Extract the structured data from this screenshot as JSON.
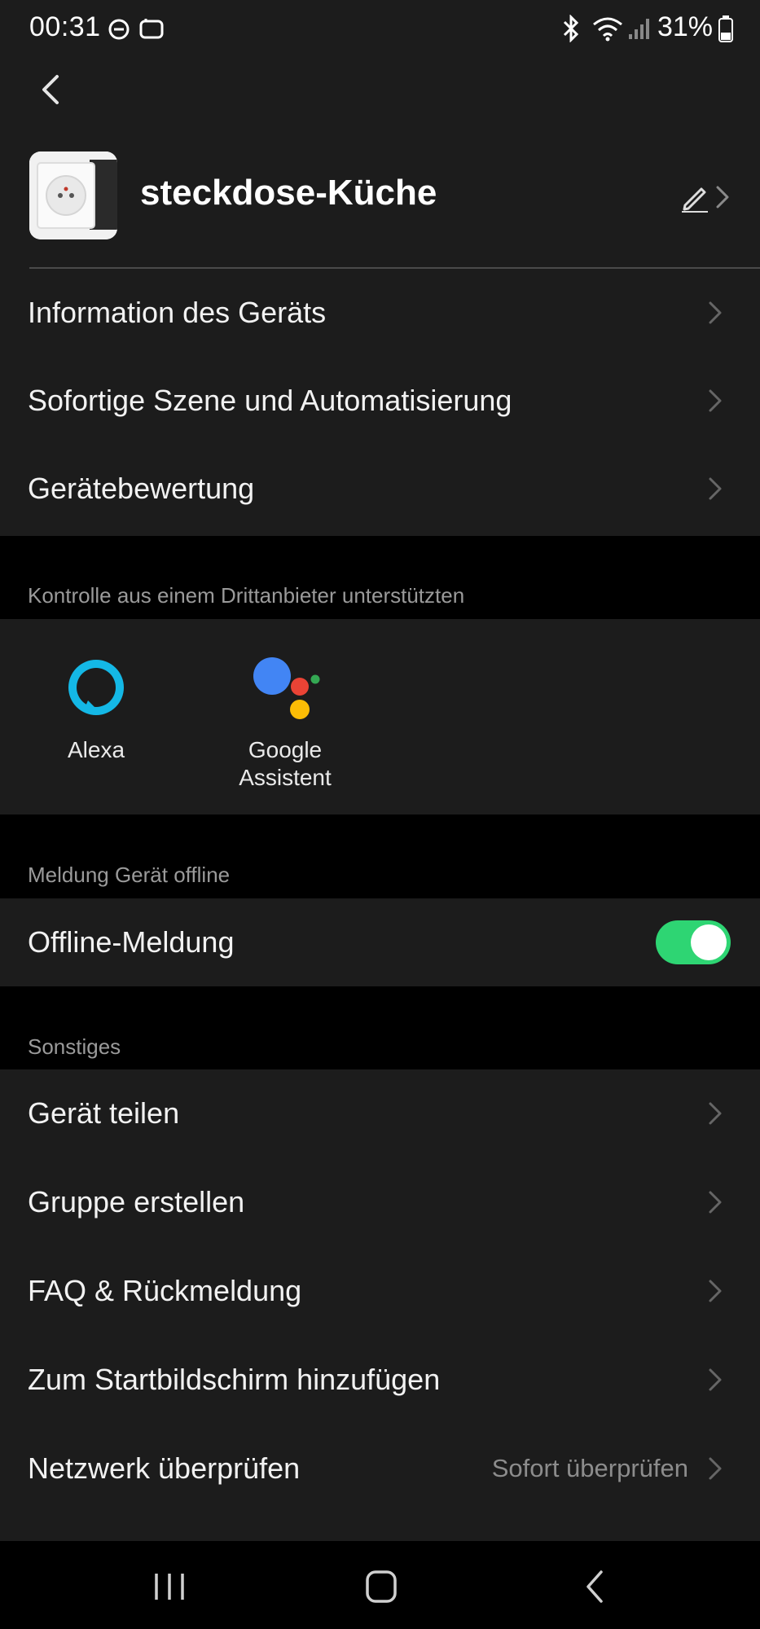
{
  "status_bar": {
    "time": "00:31",
    "battery": "31%",
    "icons": [
      "do-not-disturb-icon",
      "cast-icon",
      "bluetooth-icon",
      "wifi-icon",
      "signal-icon",
      "battery-icon"
    ]
  },
  "app_bar": {
    "back_icon": "back-arrow-icon"
  },
  "device": {
    "name": "steckdose-Küche",
    "edit_icon": "pencil-icon",
    "chevron_icon": "chevron-right-icon"
  },
  "menu_main": [
    {
      "label": "Information des Geräts"
    },
    {
      "label": "Sofortige Szene und Automatisierung"
    },
    {
      "label": "Gerätebewertung"
    }
  ],
  "third_party": {
    "title": "Kontrolle aus einem Drittanbieter unterstützten",
    "items": [
      {
        "label": "Alexa",
        "icon": "alexa-icon"
      },
      {
        "label_line1": "Google",
        "label_line2": "Assistent",
        "icon": "google-assistant-icon"
      }
    ]
  },
  "offline": {
    "title": "Meldung Gerät offline",
    "label": "Offline-Meldung",
    "enabled": true,
    "toggle_color": "#2ed573"
  },
  "others": {
    "title": "Sonstiges",
    "items": [
      {
        "label": "Gerät teilen"
      },
      {
        "label": "Gruppe erstellen"
      },
      {
        "label": "FAQ & Rückmeldung"
      },
      {
        "label": "Zum Startbildschirm hinzufügen"
      },
      {
        "label": "Netzwerk überprüfen",
        "value": "Sofort überprüfen"
      }
    ]
  },
  "nav_bar": {
    "icons": [
      "recent-apps-icon",
      "home-icon",
      "back-icon"
    ]
  },
  "colors": {
    "background": "#000000",
    "surface": "#1c1c1c",
    "text_primary": "#f2f2f2",
    "text_secondary": "#9a9a9a",
    "accent_green": "#2ed573"
  }
}
